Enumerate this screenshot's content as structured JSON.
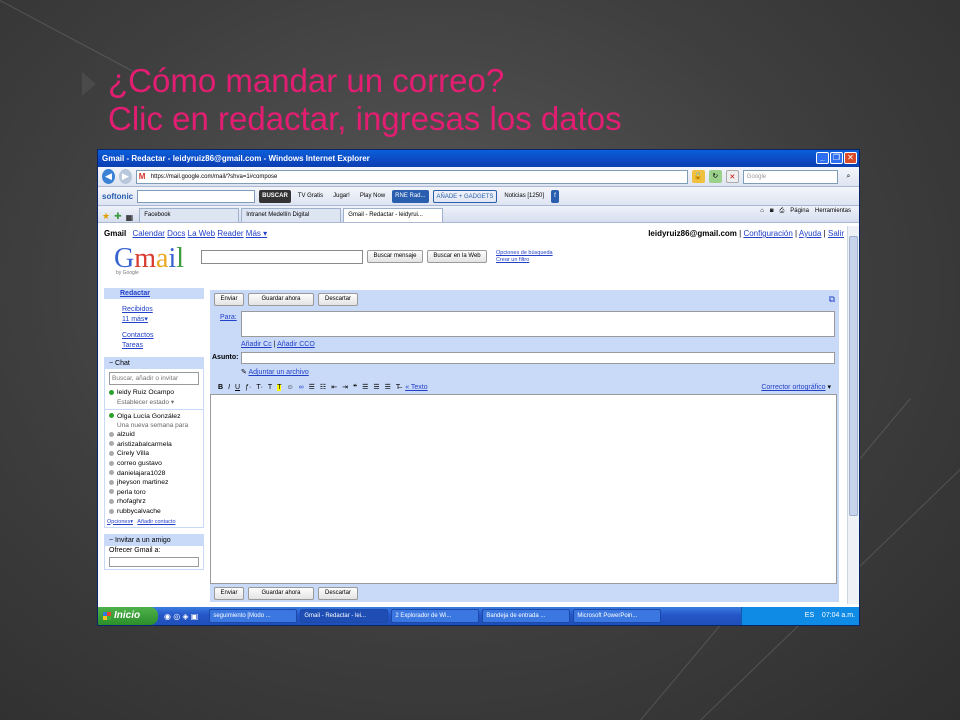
{
  "slide": {
    "title_line1": "¿Cómo mandar un correo?",
    "title_line2": "Clic en redactar, ingresas los datos"
  },
  "window": {
    "title": "Gmail - Redactar - leidyruiz86@gmail.com - Windows Internet Explorer",
    "address": "https://mail.google.com/mail/?shva=1#compose",
    "search_placeholder": "Google"
  },
  "toolbar": {
    "softonic": "softonic",
    "buscar": "BUSCAR",
    "tv_gratis": "TV Gratis",
    "jugar": "Jugar!",
    "play_now": "Play Now",
    "rne": "RNE Rad...",
    "gadgets": "AÑADE + GADGETS",
    "noticias": "Noticias [1250]"
  },
  "tabs": {
    "items": [
      "Facebook",
      "Intranet Medellín Digital",
      "Gmail - Redactar - leidyrui..."
    ],
    "pagina": "Página",
    "herramientas": "Herramientas"
  },
  "gmail": {
    "nav": [
      "Gmail",
      "Calendar",
      "Docs",
      "La Web",
      "Reader",
      "Más ▾"
    ],
    "user_email": "leidyruiz86@gmail.com",
    "configuracion": "Configuración",
    "ayuda": "Ayuda",
    "salir": "Salir",
    "logo_sub": "by Google",
    "buscar_mensaje": "Buscar mensaje",
    "buscar_web": "Buscar en la Web",
    "opciones_busqueda": "Opciones de búsqueda",
    "crear_filtro": "Crear un filtro",
    "redactar": "Redactar",
    "recibidos": "Recibidos",
    "mas": "11 más▾",
    "contactos": "Contactos",
    "tareas": "Tareas",
    "chat_head": "−  Chat",
    "chat_placeholder": "Buscar, añadir o invitar",
    "me": "leidy Ruiz Ocampo",
    "status": "Establecer estado",
    "contacts": [
      {
        "name": "Olga Lucía González",
        "online": true
      },
      {
        "name": "Una nueva semana para",
        "online": false,
        "sub": true
      },
      {
        "name": "alzuid",
        "online": false
      },
      {
        "name": "aristizabalcarmela",
        "online": false
      },
      {
        "name": "Cirely Villa",
        "online": false
      },
      {
        "name": "correo gustavo",
        "online": false
      },
      {
        "name": "danielajara1028",
        "online": false
      },
      {
        "name": "jheyson martinez",
        "online": false
      },
      {
        "name": "perla toro",
        "online": false
      },
      {
        "name": "rhofaghrz",
        "online": false
      },
      {
        "name": "rubbycalvache",
        "online": false
      }
    ],
    "opciones": "Opciones▾",
    "anadir_contacto": "Añadir contacto",
    "invitar_head": "−  Invitar a un amigo",
    "ofrecer": "Ofrecer Gmail a:",
    "compose": {
      "enviar": "Enviar",
      "guardar": "Guardar ahora",
      "descartar": "Descartar",
      "para": "Para:",
      "anadir_cc": "Añadir Cc",
      "anadir_cco": "Añadir CCO",
      "asunto": "Asunto:",
      "adjuntar": "Adjuntar un archivo",
      "texto": "« Texto",
      "corrector": "Corrector ortográfico"
    }
  },
  "taskbar": {
    "start": "Inicio",
    "tasks": [
      "seguimiento [Modo ...",
      "Gmail - Redactar - lei...",
      "2 Explorador de Wi...",
      "Bandeja de entrada ...",
      "Microsoft PowerPoin..."
    ],
    "lang": "ES",
    "clock": "07:04 a.m."
  }
}
